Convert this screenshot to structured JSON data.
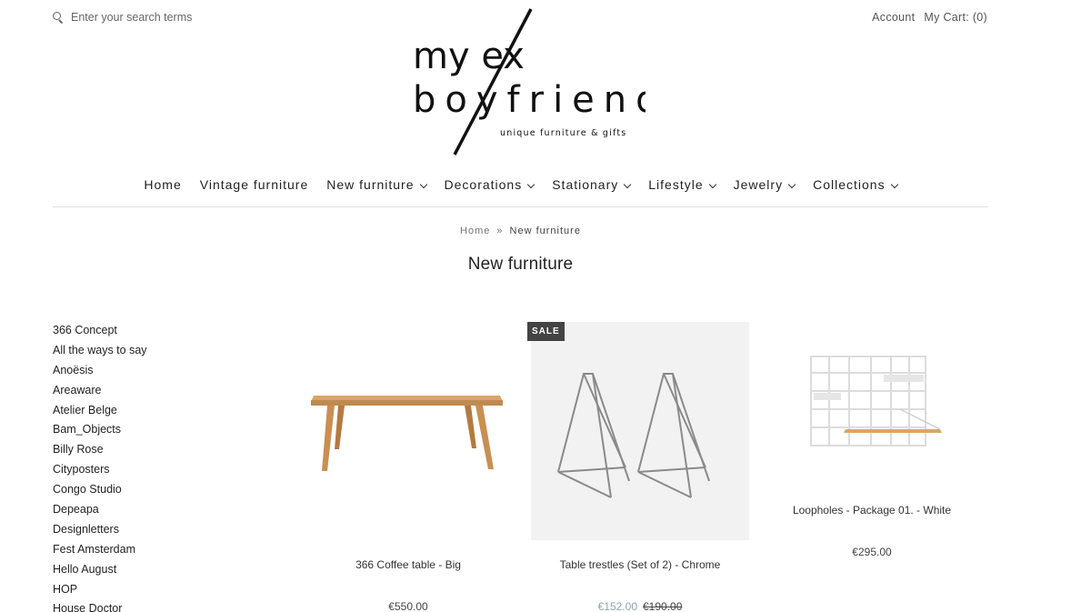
{
  "search": {
    "placeholder": "Enter your search terms"
  },
  "header": {
    "account_label": "Account",
    "cart_label": "My Cart: (0)"
  },
  "logo": {
    "line1": "my ex",
    "line2": "boyfriend",
    "tagline": "unique furniture & gifts"
  },
  "nav": {
    "items": [
      {
        "label": "Home",
        "has_dropdown": false
      },
      {
        "label": "Vintage furniture",
        "has_dropdown": false
      },
      {
        "label": "New furniture",
        "has_dropdown": true
      },
      {
        "label": "Decorations",
        "has_dropdown": true
      },
      {
        "label": "Stationary",
        "has_dropdown": true
      },
      {
        "label": "Lifestyle",
        "has_dropdown": true
      },
      {
        "label": "Jewelry",
        "has_dropdown": true
      },
      {
        "label": "Collections",
        "has_dropdown": true
      }
    ]
  },
  "breadcrumb": {
    "home": "Home",
    "separator": "»",
    "current": "New furniture"
  },
  "page_title": "New furniture",
  "sidebar": {
    "items": [
      "366 Concept",
      "All the ways to say",
      "Anoësis",
      "Areaware",
      "Atelier Belge",
      "Bam_Objects",
      "Billy Rose",
      "Cityposters",
      "Congo Studio",
      "Depeapa",
      "Designletters",
      "Fest Amsterdam",
      "Hello August",
      "HOP",
      "House Doctor"
    ]
  },
  "products": [
    {
      "name": "366 Coffee table - Big",
      "price": "€550.00",
      "image_icon": "coffee-table-image"
    },
    {
      "name": "Table trestles (Set of 2) - Chrome",
      "sale_price": "€152.00",
      "compare_price": "€190.00",
      "badge": "SALE",
      "image_icon": "trestles-image"
    },
    {
      "name": "Loopholes - Package 01. - White",
      "price": "€295.00",
      "image_icon": "wall-shelf-image"
    }
  ],
  "colors": {
    "sale_price": "#8fa3ad",
    "badge_bg": "#444444",
    "text": "#222222"
  }
}
